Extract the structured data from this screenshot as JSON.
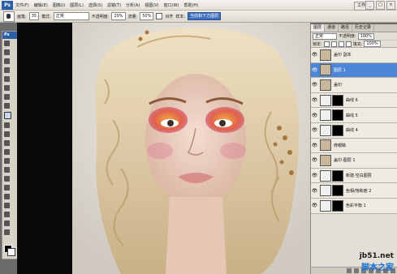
{
  "menubar": {
    "logo": "Ps",
    "items": [
      "文件(F)",
      "编辑(E)",
      "图像(I)",
      "图层(L)",
      "选择(S)",
      "滤镜(T)",
      "分析(A)",
      "视图(V)",
      "窗口(W)",
      "帮助(H)"
    ]
  },
  "options": {
    "brush_label": "画笔:",
    "brush_size": "35",
    "mode_label": "模式:",
    "mode_value": "正常",
    "opacity_label": "不透明度:",
    "opacity_value": "20%",
    "flow_label": "流量:",
    "flow_value": "50%",
    "align_label": "对齐",
    "sample_label": "样本:",
    "sample_value": "当前和下方图层",
    "workspace": "工作区"
  },
  "toolbox": {
    "title": "Ps"
  },
  "layers_panel": {
    "tabs": [
      "图层",
      "通道",
      "路径",
      "历史记录"
    ],
    "blend_mode": "正常",
    "opacity_label": "不透明度:",
    "opacity_value": "100%",
    "lock_label": "锁定:",
    "fill_label": "填充:",
    "fill_value": "100%",
    "layers": [
      {
        "name": "盖印 副本",
        "selected": false,
        "mask": false
      },
      {
        "name": "图层 1",
        "selected": true,
        "mask": false
      },
      {
        "name": "盖印",
        "selected": false,
        "mask": false
      },
      {
        "name": "曲线 6",
        "selected": false,
        "mask": true
      },
      {
        "name": "曲线 5",
        "selected": false,
        "mask": true
      },
      {
        "name": "曲线 4",
        "selected": false,
        "mask": true
      },
      {
        "name": "修眼睛",
        "selected": false,
        "mask": false
      },
      {
        "name": "盖印-图层 1",
        "selected": false,
        "mask": false
      },
      {
        "name": "新建-空白图层",
        "selected": false,
        "mask": true
      },
      {
        "name": "色相/饱和度 2",
        "selected": false,
        "mask": true
      },
      {
        "name": "色彩平衡 1",
        "selected": false,
        "mask": true
      }
    ]
  },
  "watermark": {
    "line1": "jb51.net",
    "line2": "脚本之家"
  }
}
